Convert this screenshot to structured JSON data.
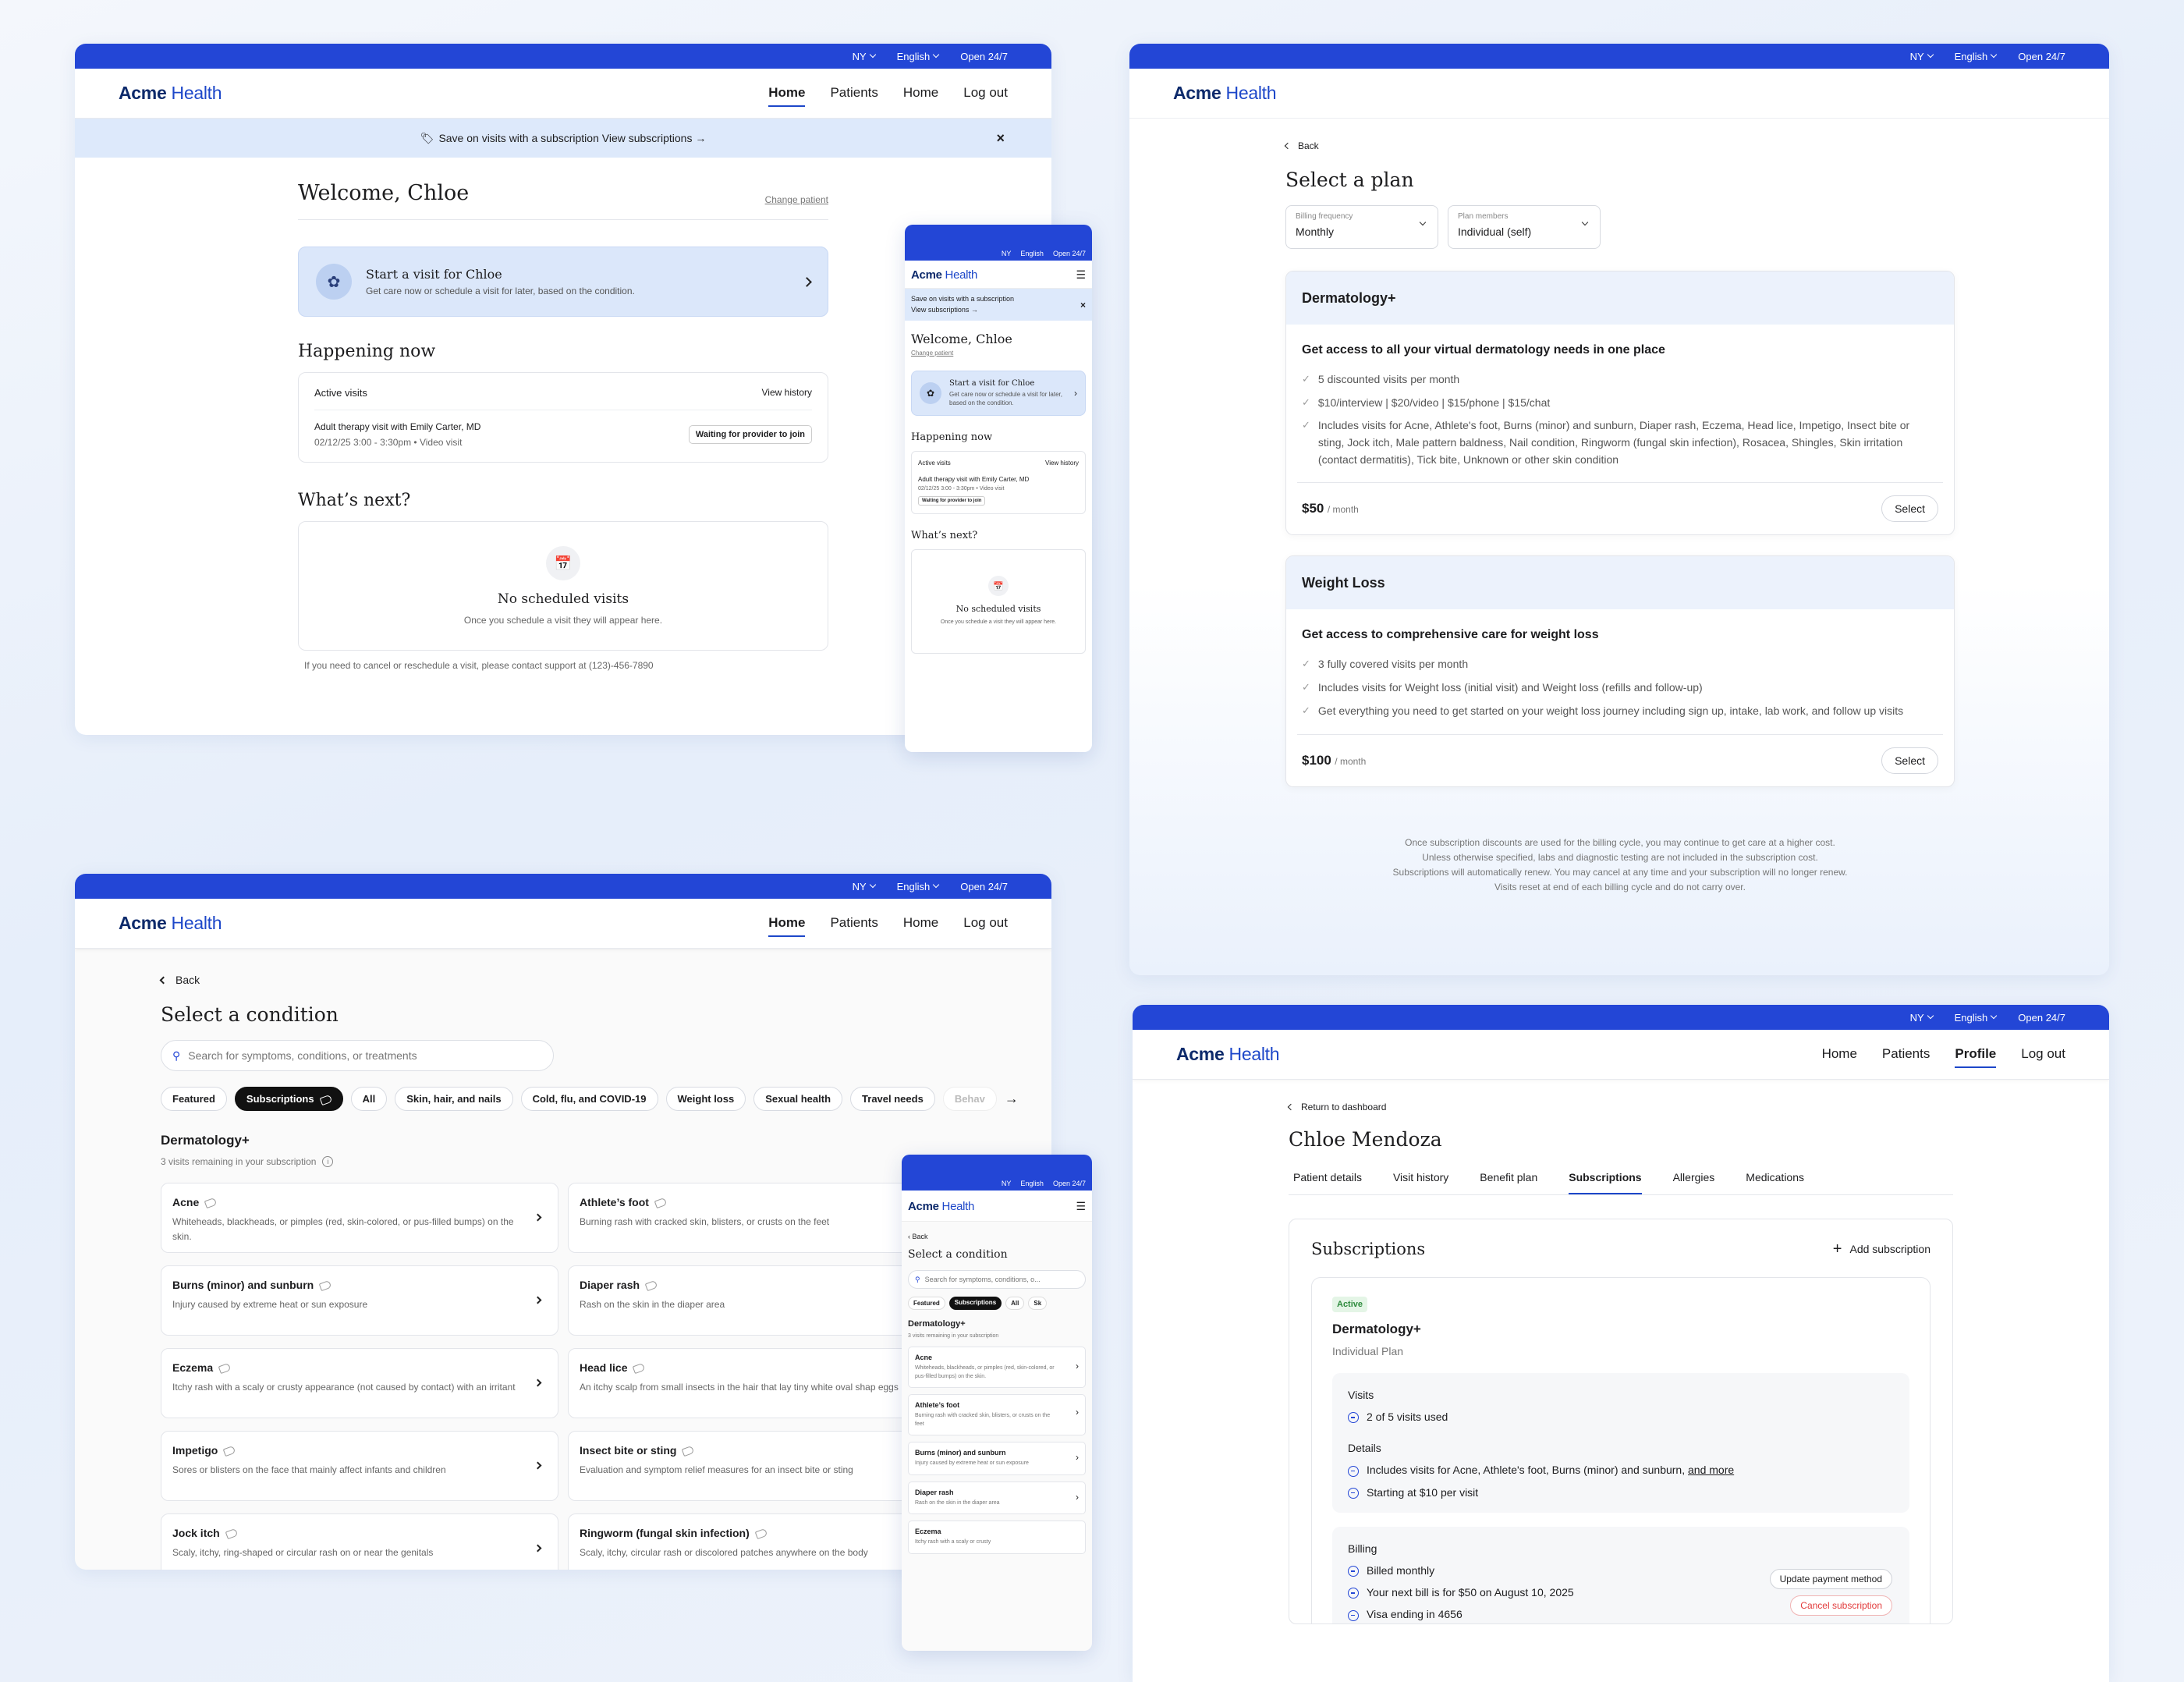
{
  "topbar": {
    "state": "NY",
    "language": "English",
    "hours": "Open 24/7"
  },
  "logo": {
    "bold": "Acme",
    "light": "Health"
  },
  "nav": {
    "home": "Home",
    "patients": "Patients",
    "home2": "Home",
    "logout": "Log out",
    "profile": "Profile"
  },
  "dashboard": {
    "banner": "Save on visits with a subscription View subscriptions →",
    "banner_mobile_1": "Save on visits with a subscription",
    "banner_mobile_2": "View subscriptions →",
    "welcome": "Welcome, Chloe",
    "change_patient": "Change patient",
    "start_title": "Start a visit for Chloe",
    "start_sub": "Get care now or schedule a visit for later, based on the condition.",
    "happening": "Happening now",
    "active_visits": "Active visits",
    "view_history": "View history",
    "visit_title": "Adult therapy visit with Emily Carter, MD",
    "visit_meta": "02/12/25 3:00 - 3:30pm • Video visit",
    "waiting": "Waiting for provider to join",
    "whats_next": "What’s next?",
    "no_visits": "No scheduled visits",
    "no_visits_sub": "Once you schedule a visit they will appear here.",
    "support": "If you need to cancel or reschedule a visit, please contact support at (123)-456-7890"
  },
  "plan": {
    "back": "Back",
    "title": "Select a plan",
    "billing_label": "Billing frequency",
    "billing_value": "Monthly",
    "members_label": "Plan members",
    "members_value": "Individual (self)",
    "derm": {
      "name": "Dermatology+",
      "headline": "Get access to all your virtual dermatology needs in one place",
      "f1": "5 discounted visits per month",
      "f2": "$10/interview | $20/video | $15/phone | $15/chat",
      "f3": "Includes visits for Acne, Athlete's foot, Burns (minor) and sunburn, Diaper rash, Eczema, Head lice, Impetigo, Insect bite or sting, Jock itch, Male pattern baldness, Nail condition, Ringworm (fungal skin infection), Rosacea, Shingles, Skin irritation (contact dermatitis), Tick bite, Unknown or other skin condition",
      "price": "$50",
      "per": "/ month",
      "select": "Select"
    },
    "wl": {
      "name": "Weight Loss",
      "headline": "Get access to comprehensive care for weight loss",
      "f1": "3 fully covered visits per month",
      "f2": "Includes visits for Weight loss (initial visit) and Weight loss (refills and follow-up)",
      "f3": "Get everything you need to get started on your weight loss journey including sign up, intake, lab work, and follow up visits",
      "price": "$100",
      "per": "/ month",
      "select": "Select"
    },
    "foot1": "Once subscription discounts are used for the billing cycle, you may continue to get care at a higher cost.",
    "foot2": "Unless otherwise specified, labs and diagnostic testing are not included in the subscription cost.",
    "foot3": "Subscriptions will automatically renew. You may cancel at any time and your subscription will no longer renew.",
    "foot4": "Visits reset at end of each billing cycle and do not carry over."
  },
  "condition": {
    "back": "Back",
    "title": "Select a condition",
    "search_placeholder": "Search for symptoms, conditions, or treatments",
    "search_placeholder_mobile": "Search for symptoms, conditions, o...",
    "chips": [
      "Featured",
      "Subscriptions",
      "All",
      "Skin, hair, and nails",
      "Cold, flu, and COVID-19",
      "Weight loss",
      "Sexual health",
      "Travel needs",
      "Behav"
    ],
    "section": "Dermatology+",
    "remaining": "3 visits remaining in your subscription",
    "items": [
      {
        "name": "Acne",
        "desc": "Whiteheads, blackheads, or pimples (red, skin-colored, or pus-filled bumps) on the skin."
      },
      {
        "name": "Athlete’s foot",
        "desc": "Burning rash with cracked skin, blisters, or crusts on the feet"
      },
      {
        "name": "Burns (minor) and sunburn",
        "desc": "Injury caused by extreme heat or sun exposure"
      },
      {
        "name": "Diaper rash",
        "desc": "Rash on the skin in the diaper area"
      },
      {
        "name": "Eczema",
        "desc": "Itchy rash with a scaly or crusty appearance (not caused by contact) with an irritant"
      },
      {
        "name": "Head lice",
        "desc": "An itchy scalp from small insects in the hair that lay tiny white oval shap eggs (nits)"
      },
      {
        "name": "Impetigo",
        "desc": "Sores or blisters on the face that mainly affect infants and children"
      },
      {
        "name": "Insect bite or sting",
        "desc": "Evaluation and symptom relief measures for an insect bite or sting"
      },
      {
        "name": "Jock itch",
        "desc": "Scaly, itchy, ring-shaped or circular rash on or near the genitals"
      },
      {
        "name": "Ringworm (fungal skin infection)",
        "desc": "Scaly, itchy, circular rash or discolored patches anywhere on the body"
      }
    ],
    "mobile_items": [
      {
        "name": "Acne",
        "desc": "Whiteheads, blackheads, or pimples (red, skin-colored, or pus-filled bumps) on the skin."
      },
      {
        "name": "Athlete’s foot",
        "desc": "Burning rash with cracked skin, blisters, or crusts on the feet"
      },
      {
        "name": "Burns (minor) and sunburn",
        "desc": "Injury caused by extreme heat or sun exposure"
      },
      {
        "name": "Diaper rash",
        "desc": "Rash on the skin in the diaper area"
      },
      {
        "name": "Eczema",
        "desc": "Itchy rash with a scaly or crusty"
      }
    ],
    "mobile_chips": [
      "Featured",
      "Subscriptions",
      "All",
      "Sk"
    ]
  },
  "profile": {
    "back": "Return to dashboard",
    "name": "Chloe Mendoza",
    "tabs": [
      "Patient details",
      "Visit history",
      "Benefit plan",
      "Subscriptions",
      "Allergies",
      "Medications"
    ],
    "section": "Subscriptions",
    "add": "Add subscription",
    "badge": "Active",
    "plan_name": "Dermatology+",
    "plan_type": "Individual Plan",
    "visits_label": "Visits",
    "visits_used": "2 of 5 visits used",
    "details_label": "Details",
    "detail1": "Includes visits for Acne, Athlete's foot, Burns (minor) and sunburn,",
    "and_more": "and more",
    "detail2": "Starting at $10 per visit",
    "billing_label": "Billing",
    "bill1": "Billed monthly",
    "bill2": "Your next bill is for $50 on August 10, 2025",
    "bill3": "Visa ending in 4656",
    "update": "Update payment method",
    "cancel": "Cancel subscription"
  },
  "colors": {
    "primary": "#2346d6",
    "banner": "#dde9fb",
    "active_green": "#2e8b3d",
    "danger": "#e23b3b"
  }
}
